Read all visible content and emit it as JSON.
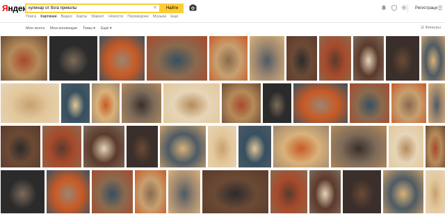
{
  "header": {
    "logo": "Яндекс",
    "search_value": "кулинар от бога приколы",
    "find_label": "Найти",
    "register_label": "Регистрация"
  },
  "tabs": [
    {
      "label": "Поиск"
    },
    {
      "label": "Картинки",
      "active": true
    },
    {
      "label": "Видео"
    },
    {
      "label": "Карты"
    },
    {
      "label": "Маркет"
    },
    {
      "label": "Новости"
    },
    {
      "label": "Переводчик"
    },
    {
      "label": "Музыка"
    },
    {
      "label": "Ещё"
    }
  ],
  "filters": [
    {
      "label": "Моя лента"
    },
    {
      "label": "Мои коллекции"
    },
    {
      "label": "Темы ▾"
    },
    {
      "label": "Ещё ▾"
    }
  ],
  "filter_button": "☰ Фильтры",
  "colors": {
    "accent": "#ffcc33",
    "brand_red": "#ff0000"
  }
}
